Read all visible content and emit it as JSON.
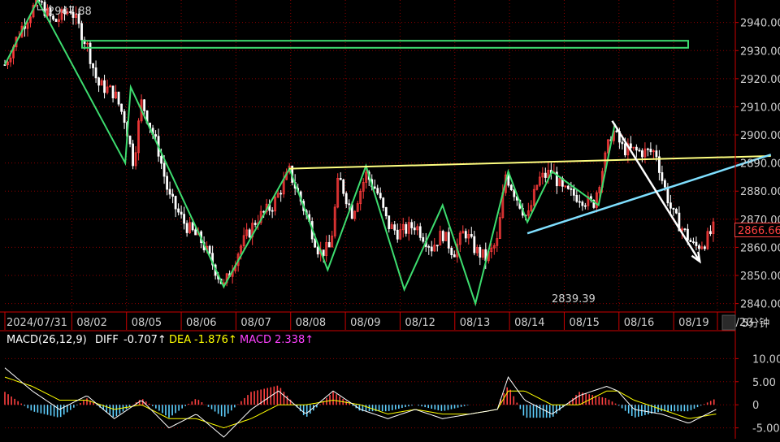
{
  "chart_data": [
    {
      "type": "candlestick",
      "x_labels": [
        "2024/07/31",
        "08/02",
        "08/05",
        "08/06",
        "08/07",
        "08/08",
        "08/09",
        "08/12",
        "08/13",
        "08/14",
        "08/15",
        "08/16",
        "08/19",
        "08/20"
      ],
      "y_ticks": [
        "2840.00",
        "2850.00",
        "2860.00",
        "2870.00",
        "2880.00",
        "2890.00",
        "2900.00",
        "2910.00",
        "2920.00",
        "2930.00",
        "2940.00"
      ],
      "ylim": [
        2837,
        2948
      ],
      "annotations": {
        "high_label": "2947.88",
        "low_label": "2839.39",
        "current_price": "2866.66"
      },
      "period_label": "5分钟",
      "zigzag": [
        [
          0,
          2925
        ],
        [
          0.6,
          2947.88
        ],
        [
          2.2,
          2890
        ],
        [
          2.3,
          2917
        ],
        [
          4.0,
          2846
        ],
        [
          5.2,
          2888
        ],
        [
          5.9,
          2852
        ],
        [
          6.6,
          2889
        ],
        [
          7.3,
          2845
        ],
        [
          8.0,
          2875
        ],
        [
          8.6,
          2840
        ],
        [
          9.2,
          2887
        ],
        [
          9.55,
          2869
        ],
        [
          10.0,
          2887
        ],
        [
          10.85,
          2875
        ],
        [
          11.15,
          2904
        ]
      ],
      "resistance_box": [
        2931,
        2933.5
      ],
      "yellow_trendline": [
        [
          5.2,
          2888
        ],
        [
          14.0,
          2892.5
        ]
      ],
      "cyan_trendline": [
        [
          9.55,
          2865
        ],
        [
          14.0,
          2893
        ]
      ],
      "white_arrow": [
        [
          11.1,
          2905
        ],
        [
          12.7,
          2855
        ]
      ],
      "price_path": [
        [
          0,
          2925
        ],
        [
          0.3,
          2938
        ],
        [
          0.6,
          2947.88
        ],
        [
          0.9,
          2940
        ],
        [
          1.2,
          2945
        ],
        [
          1.5,
          2932
        ],
        [
          1.7,
          2918
        ],
        [
          2.0,
          2915
        ],
        [
          2.2,
          2905
        ],
        [
          2.35,
          2890
        ],
        [
          2.5,
          2912
        ],
        [
          2.8,
          2895
        ],
        [
          3.0,
          2878
        ],
        [
          3.3,
          2868
        ],
        [
          3.6,
          2862
        ],
        [
          3.85,
          2852
        ],
        [
          4.0,
          2846
        ],
        [
          4.3,
          2860
        ],
        [
          4.6,
          2870
        ],
        [
          4.9,
          2875
        ],
        [
          5.2,
          2887
        ],
        [
          5.5,
          2872
        ],
        [
          5.75,
          2858
        ],
        [
          5.95,
          2860
        ],
        [
          6.1,
          2885
        ],
        [
          6.35,
          2872
        ],
        [
          6.6,
          2886
        ],
        [
          6.8,
          2880
        ],
        [
          7.0,
          2868
        ],
        [
          7.2,
          2865
        ],
        [
          7.5,
          2868
        ],
        [
          7.8,
          2860
        ],
        [
          8.0,
          2865
        ],
        [
          8.2,
          2858
        ],
        [
          8.4,
          2866
        ],
        [
          8.6,
          2859
        ],
        [
          8.8,
          2856
        ],
        [
          9.0,
          2862
        ],
        [
          9.15,
          2886
        ],
        [
          9.3,
          2880
        ],
        [
          9.55,
          2870
        ],
        [
          9.75,
          2884
        ],
        [
          10.0,
          2887
        ],
        [
          10.2,
          2880
        ],
        [
          10.5,
          2878
        ],
        [
          10.75,
          2875
        ],
        [
          10.95,
          2890
        ],
        [
          11.1,
          2902
        ],
        [
          11.3,
          2895
        ],
        [
          11.6,
          2894
        ],
        [
          11.9,
          2894
        ],
        [
          12.0,
          2885
        ],
        [
          12.2,
          2872
        ],
        [
          12.4,
          2866
        ],
        [
          12.6,
          2860
        ],
        [
          12.8,
          2862
        ],
        [
          12.95,
          2866.66
        ]
      ]
    },
    {
      "type": "macd",
      "title": "MACD(26,12,9)",
      "diff_label": "DIFF",
      "diff_value": "-0.707↑",
      "dea_label": "DEA",
      "dea_value": "-1.876↑",
      "macd_label": "MACD",
      "macd_value": "2.338↑",
      "y_ticks": [
        "10.00",
        "5.00",
        "0",
        "-5.00"
      ],
      "ylim": [
        -7,
        12
      ],
      "diff_path": [
        [
          0,
          8
        ],
        [
          0.5,
          3
        ],
        [
          1.0,
          -1
        ],
        [
          1.5,
          2
        ],
        [
          2.0,
          -3
        ],
        [
          2.5,
          1
        ],
        [
          3.0,
          -5
        ],
        [
          3.5,
          -2
        ],
        [
          4.0,
          -7
        ],
        [
          4.5,
          -1
        ],
        [
          5.0,
          3
        ],
        [
          5.5,
          -2
        ],
        [
          6.0,
          3
        ],
        [
          6.5,
          -1
        ],
        [
          7.0,
          -3
        ],
        [
          7.5,
          -1
        ],
        [
          8.0,
          -3
        ],
        [
          8.5,
          -2
        ],
        [
          9.0,
          -1
        ],
        [
          9.2,
          6
        ],
        [
          9.5,
          1
        ],
        [
          10.0,
          -2
        ],
        [
          10.5,
          2
        ],
        [
          11.0,
          4
        ],
        [
          11.2,
          3
        ],
        [
          11.5,
          -1
        ],
        [
          12.0,
          -2
        ],
        [
          12.5,
          -4
        ],
        [
          13.0,
          -1
        ]
      ],
      "dea_path": [
        [
          0,
          6
        ],
        [
          0.5,
          4
        ],
        [
          1.0,
          1
        ],
        [
          1.5,
          1
        ],
        [
          2.0,
          -1
        ],
        [
          2.5,
          0
        ],
        [
          3.0,
          -3
        ],
        [
          3.5,
          -3
        ],
        [
          4.0,
          -5
        ],
        [
          4.5,
          -3
        ],
        [
          5.0,
          0
        ],
        [
          5.5,
          0
        ],
        [
          6.0,
          1
        ],
        [
          6.5,
          0
        ],
        [
          7.0,
          -2
        ],
        [
          7.5,
          -1
        ],
        [
          8.0,
          -2
        ],
        [
          8.5,
          -2
        ],
        [
          9.0,
          -1
        ],
        [
          9.2,
          3
        ],
        [
          9.5,
          3
        ],
        [
          10.0,
          0
        ],
        [
          10.5,
          0
        ],
        [
          11.0,
          3
        ],
        [
          11.2,
          3
        ],
        [
          11.5,
          1
        ],
        [
          12.0,
          -1
        ],
        [
          12.5,
          -3
        ],
        [
          13.0,
          -2
        ]
      ]
    }
  ],
  "colors": {
    "background": "#000000",
    "candle_up": "#ff3b3b",
    "candle_down": "#ffffff",
    "zigzag": "#3ddc6f",
    "box": "#3ddc6f",
    "yellow_line": "#ffff80",
    "cyan_line": "#7fdfff",
    "arrow": "#ffffff",
    "grid": "#8b0000",
    "price_tag": "#ff4040",
    "macd_pos": "#ff4040",
    "macd_neg": "#5fd0ff",
    "diff": "#ffffff",
    "dea": "#ffff00",
    "macd_text": "#ff40ff"
  }
}
